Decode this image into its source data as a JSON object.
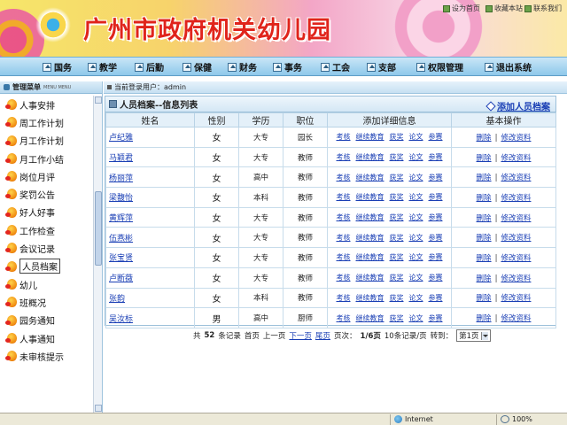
{
  "banner": {
    "title": "广州市政府机关幼儿园",
    "util": [
      "设为首页",
      "收藏本站",
      "联系我们"
    ]
  },
  "nav": [
    {
      "label": "国务"
    },
    {
      "label": "教学"
    },
    {
      "label": "后勤"
    },
    {
      "label": "保健"
    },
    {
      "label": "财务"
    },
    {
      "label": "事务"
    },
    {
      "label": "工会"
    },
    {
      "label": "支部"
    },
    {
      "label": "权限管理"
    },
    {
      "label": "退出系统"
    }
  ],
  "sidebar": {
    "title": "管理菜单",
    "subtitle": "MENU MENU",
    "items": [
      {
        "label": "人事安排"
      },
      {
        "label": "周工作计划"
      },
      {
        "label": "月工作计划"
      },
      {
        "label": "月工作小结"
      },
      {
        "label": "岗位月评"
      },
      {
        "label": "奖罚公告"
      },
      {
        "label": "好人好事"
      },
      {
        "label": "工作检查"
      },
      {
        "label": "会议记录"
      },
      {
        "label": "人员档案"
      },
      {
        "label": "幼儿"
      },
      {
        "label": "班概况"
      },
      {
        "label": "园务通知"
      },
      {
        "label": "人事通知"
      },
      {
        "label": "未审核提示"
      }
    ]
  },
  "infobar": {
    "text": "当前登录用户：admin"
  },
  "panel": {
    "title": "人员档案--信息列表",
    "add_label": "添加人员档案",
    "headers": [
      "姓名",
      "性别",
      "学历",
      "职位",
      "添加详细信息",
      "基本操作"
    ],
    "detail_links": [
      "考核",
      "继续教育",
      "获奖",
      "论文",
      "参赛"
    ],
    "ops": [
      "删除",
      "修改资料"
    ],
    "rows": [
      {
        "name": "卢纪雅",
        "gender": "女",
        "edu": "大专",
        "pos": "园长"
      },
      {
        "name": "马颖君",
        "gender": "女",
        "edu": "大专",
        "pos": "教师"
      },
      {
        "name": "杨丽萍",
        "gender": "女",
        "edu": "高中",
        "pos": "教师"
      },
      {
        "name": "梁馥怡",
        "gender": "女",
        "edu": "本科",
        "pos": "教师"
      },
      {
        "name": "黄辉萍",
        "gender": "女",
        "edu": "大专",
        "pos": "教师"
      },
      {
        "name": "伍燕彬",
        "gender": "女",
        "edu": "大专",
        "pos": "教师"
      },
      {
        "name": "张宝贤",
        "gender": "女",
        "edu": "大专",
        "pos": "教师"
      },
      {
        "name": "卢断薇",
        "gender": "女",
        "edu": "大专",
        "pos": "教师"
      },
      {
        "name": "张韵",
        "gender": "女",
        "edu": "本科",
        "pos": "教师"
      },
      {
        "name": "吴汝标",
        "gender": "男",
        "edu": "高中",
        "pos": "厨师"
      }
    ]
  },
  "pager": {
    "total_prefix": "共",
    "total": "52",
    "total_suffix": "条记录",
    "first": "首页",
    "prev": "上一页",
    "next": "下一页",
    "last": "尾页",
    "page_label": "页次：",
    "page_value": "1/6页",
    "per_page": "10条记录/页",
    "goto": "转到：",
    "select_value": "第1页"
  },
  "status": {
    "zone": "Internet",
    "zoom": "100%"
  },
  "colors": {
    "link": "#1a3fb5",
    "banner_title": "#e0241b",
    "nav": "#8ec8ea"
  }
}
